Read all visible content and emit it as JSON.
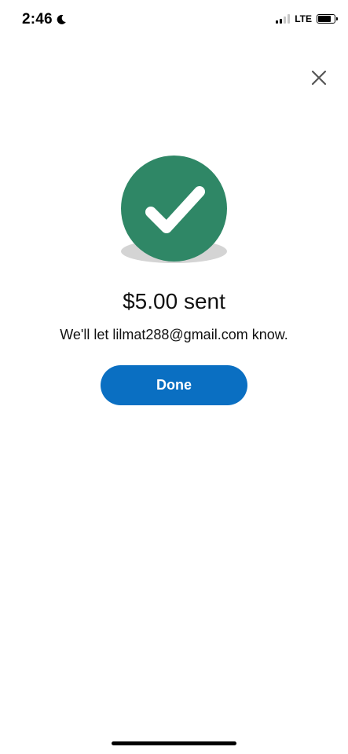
{
  "status_bar": {
    "time": "2:46",
    "network": "LTE",
    "moon_icon": "moon-icon",
    "signal_icon": "signal-icon",
    "battery_icon": "battery-icon"
  },
  "close": {
    "icon": "close-icon"
  },
  "success": {
    "icon": "check-circle-icon",
    "color": "#2f8766",
    "title": "$5.00 sent",
    "message": "We'll let lilmat288@gmail.com know."
  },
  "actions": {
    "done_label": "Done",
    "done_color": "#0a6fc2"
  }
}
